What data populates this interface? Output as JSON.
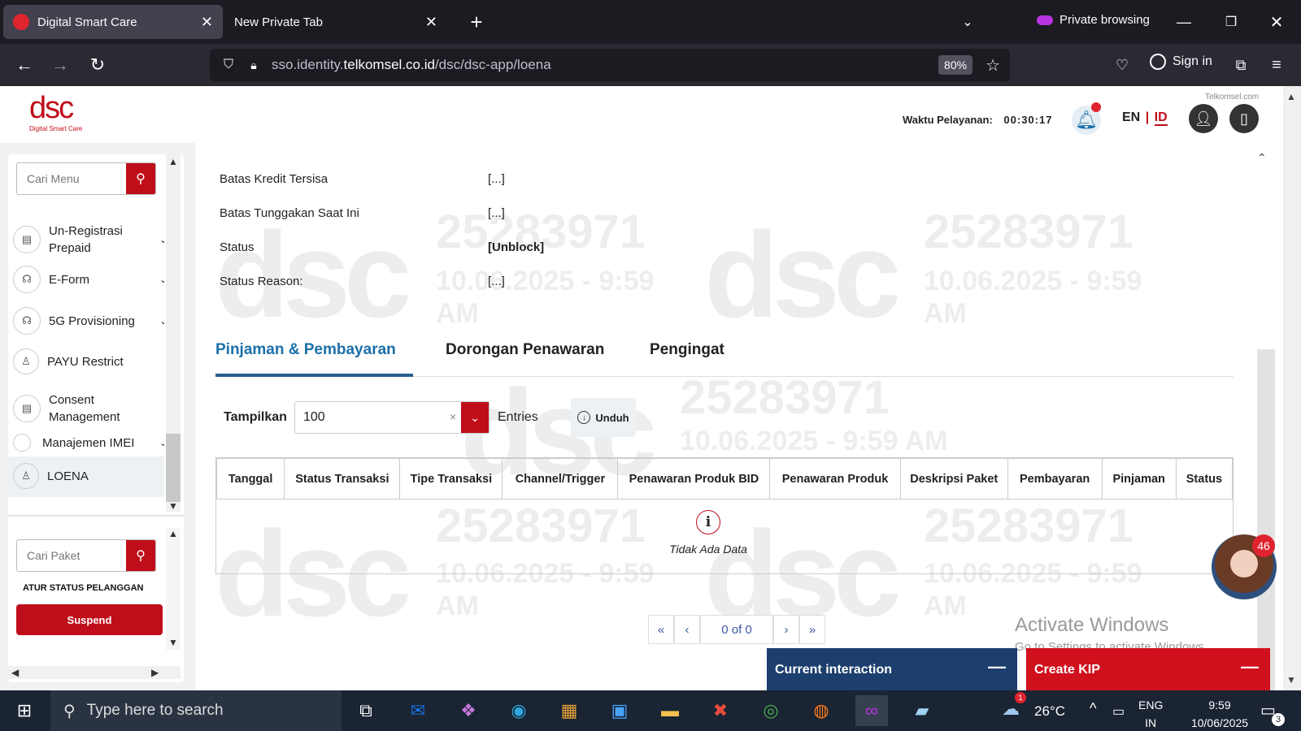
{
  "browser": {
    "tabs": [
      {
        "title": "Digital Smart Care"
      },
      {
        "title": "New Private Tab"
      }
    ],
    "private_label": "Private browsing",
    "url_prefix": "sso.identity.",
    "url_domain": "telkomsel.co.id",
    "url_path": "/dsc/dsc-app/loena",
    "zoom": "80%",
    "sign_in": "Sign in"
  },
  "header": {
    "logo_text": "dsc",
    "logo_sub": "Digital Smart Care",
    "service_time_label": "Waktu Pelayanan:",
    "service_time": "00:30:17",
    "lang_en": "EN",
    "lang_sep": "|",
    "lang_id": "ID",
    "brand_small": "Telkomsel.com"
  },
  "sidebar": {
    "search_placeholder": "Cari Menu",
    "items": [
      {
        "label": "Un-Registrasi Prepaid",
        "icon": "card-icon"
      },
      {
        "label": "E-Form",
        "icon": "headset-icon"
      },
      {
        "label": "5G Provisioning",
        "icon": "headset-icon"
      },
      {
        "label": "PAYU Restrict",
        "icon": "user-icon"
      },
      {
        "label": "Consent Management",
        "icon": "card-icon"
      },
      {
        "label": "Manajemen IMEI",
        "icon": "circle-icon"
      },
      {
        "label": "LOENA",
        "icon": "user-icon"
      }
    ],
    "package_placeholder": "Cari Paket",
    "status_title": "ATUR STATUS PELANGGAN",
    "suspend_label": "Suspend"
  },
  "info": [
    {
      "label": "Batas Kredit Tersisa",
      "value": "[...]"
    },
    {
      "label": "Batas Tunggakan Saat Ini",
      "value": "[...]"
    },
    {
      "label": "Status",
      "value": "[Unblock]"
    },
    {
      "label": "Status Reason:",
      "value": "[...]"
    }
  ],
  "watermark": {
    "id": "25283971",
    "time": "10.06.2025 - 9:59 AM"
  },
  "tabs": [
    "Pinjaman & Pembayaran",
    "Dorongan Penawaran",
    "Pengingat"
  ],
  "controls": {
    "show_label": "Tampilkan",
    "entries_value": "100",
    "entries_label": "Entries",
    "download_label": "Unduh"
  },
  "table": {
    "headers": [
      "Tanggal",
      "Status Transaksi",
      "Tipe Transaksi",
      "Channel/Trigger",
      "Penawaran Produk BID",
      "Penawaran Produk",
      "Deskripsi Paket",
      "Pembayaran",
      "Pinjaman",
      "Status"
    ],
    "empty_text": "Tidak Ada Data"
  },
  "pagination": {
    "first": "«",
    "prev": "‹",
    "info": "0 of 0",
    "next": "›",
    "last": "»"
  },
  "panels": {
    "current_interaction": "Current interaction",
    "create_kip": "Create KIP"
  },
  "avatar_badge": "46",
  "windows": {
    "activate_title": "Activate Windows",
    "activate_sub": "Go to Settings to activate Windows."
  },
  "taskbar": {
    "search_placeholder": "Type here to search",
    "weather": "26°C",
    "lang1": "ENG",
    "lang2": "IN",
    "time": "9:59",
    "date": "10/06/2025",
    "notif_count": "3",
    "weather_badge": "1"
  },
  "colors": {
    "brand_red": "#c00d1a",
    "tab_blue": "#1b6fa8",
    "kip_red": "#d0101d",
    "panel_blue": "#1d3f6e"
  }
}
